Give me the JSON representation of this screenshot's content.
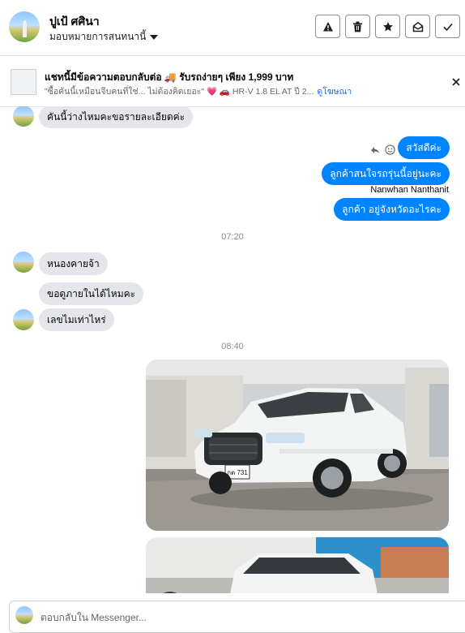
{
  "header": {
    "contact_name": "ปูเป้ ศศินา",
    "assign_label": "มอบหมายการสนทนานี้",
    "actions": [
      {
        "icon": "warning-icon"
      },
      {
        "icon": "trash-icon"
      },
      {
        "icon": "star-icon"
      },
      {
        "icon": "mark-unread-icon"
      },
      {
        "icon": "check-icon"
      }
    ]
  },
  "ad": {
    "title": "แชทนี้มีข้อความตอบกลับต่อ 🚚 รับรถง่ายๆ เพียง 1,999 บาท",
    "snippet": "\"ซื้อคันนี้เหมือนจีบคนที่ใช่... ไม่ต้องคิดเยอะ\" 💗 🚗 HR-V 1.8 EL AT ปี 2...",
    "link": "ดูโฆษณา"
  },
  "messages": {
    "m0": "คันนี้ว่างไหมคะขอรายละเอียดค่ะ",
    "m1": "สวัสดีค่ะ",
    "m2": "ลูกค้าสนใจรถรุ่นนี้อยู่นะคะ",
    "sender": "Nanwhan Nanthanit",
    "m3": "ลูกค้า อยู่จังหวัดอะไรคะ",
    "time1": "07:20",
    "m4": "หนองคายจ้า",
    "m5": "ขอดูภายในได้ไหมคะ",
    "m6": "เลขไมเท่าไหร่",
    "time2": "08:40",
    "plate": "กต 731"
  },
  "composer": {
    "placeholder": "ตอบกลับใน Messenger..."
  },
  "colors": {
    "accent": "#0084ff",
    "incoming_bubble": "#e4e6eb",
    "link": "#216fdb"
  }
}
